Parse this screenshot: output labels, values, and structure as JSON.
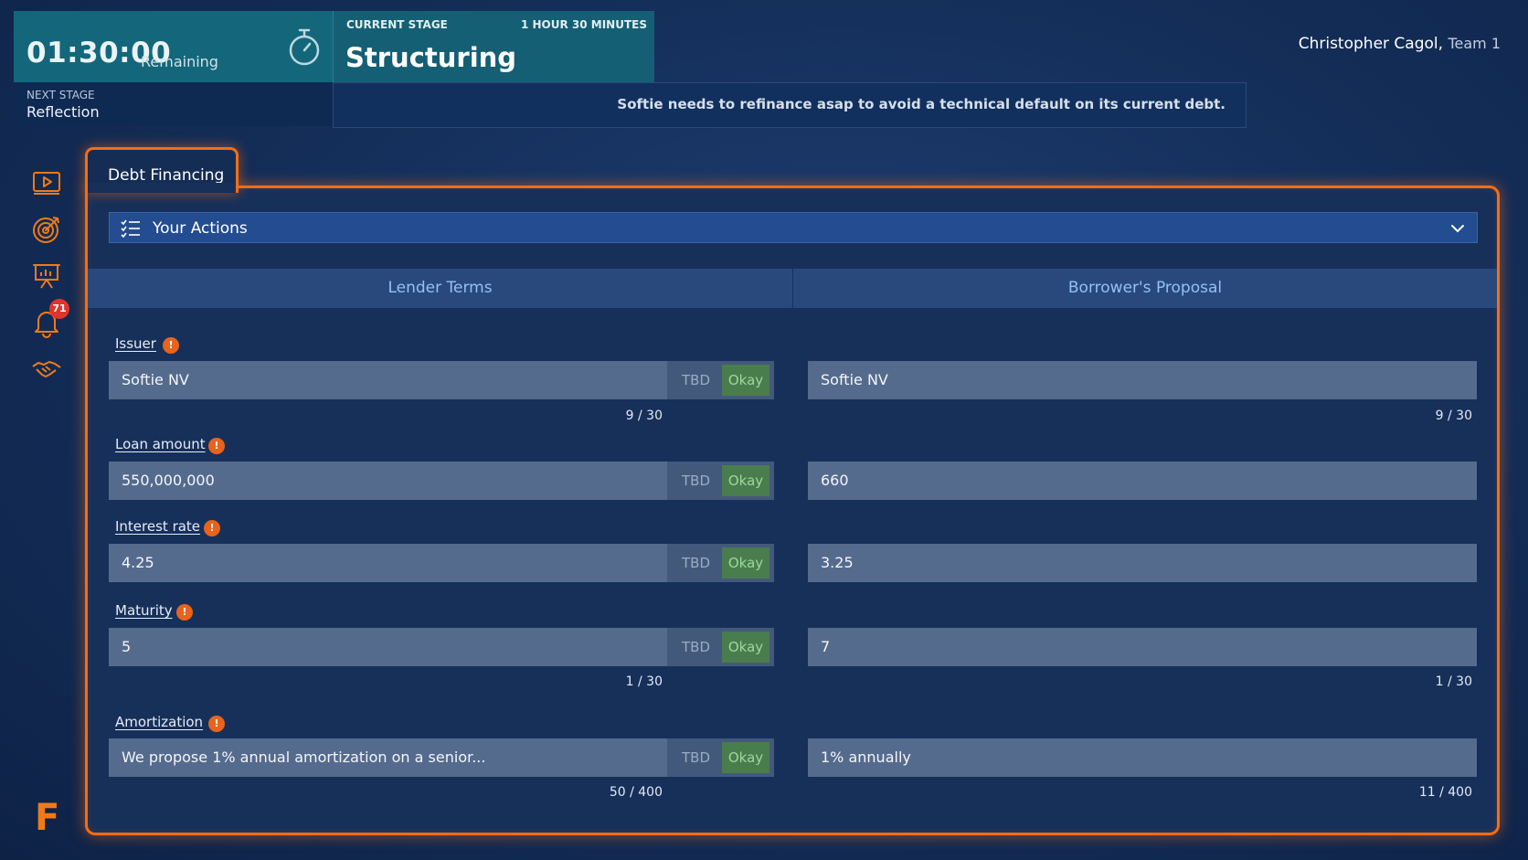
{
  "header": {
    "timer": "01:30:00",
    "remaining_label": "Remaining",
    "next_stage_label": "NEXT STAGE",
    "next_stage": "Reflection",
    "current_stage_label": "CURRENT STAGE",
    "stage_duration": "1 HOUR 30 MINUTES",
    "current_stage": "Structuring",
    "notice": "Softie needs to refinance asap to avoid a technical default on its current debt.",
    "user_name": "Christopher Cagol,",
    "user_team": "Team 1"
  },
  "sidebar": {
    "items": [
      {
        "icon": "video-play-icon"
      },
      {
        "icon": "target-icon"
      },
      {
        "icon": "presentation-board-icon"
      },
      {
        "icon": "bell-icon",
        "badge": "71"
      },
      {
        "icon": "handshake-icon"
      }
    ],
    "logo": "F",
    "accent": "#f07a17"
  },
  "panel": {
    "tab_label": "Debt Financing",
    "actions_label": "Your Actions",
    "columns": [
      "Lender Terms",
      "Borrower's Proposal"
    ]
  },
  "fields": [
    {
      "label": "Issuer",
      "lender": "Softie NV",
      "borrower": "Softie NV",
      "lender_count": "9 / 30",
      "borrower_count": "9 / 30"
    },
    {
      "label": "Loan amount",
      "lender": "550,000,000",
      "borrower": "660"
    },
    {
      "label": "Interest rate",
      "lender": "4.25",
      "borrower": "3.25"
    },
    {
      "label": "Maturity",
      "lender": "5",
      "borrower": "7",
      "lender_count": "1 / 30",
      "borrower_count": "1 / 30"
    },
    {
      "label": "Amortization",
      "lender": "We propose 1% annual amortization on a senior...",
      "borrower": "1% annually",
      "lender_count": "50 / 400",
      "borrower_count": "11 / 400"
    }
  ],
  "buttons": {
    "tbd": "TBD",
    "okay": "Okay"
  },
  "info_glyph": "!"
}
